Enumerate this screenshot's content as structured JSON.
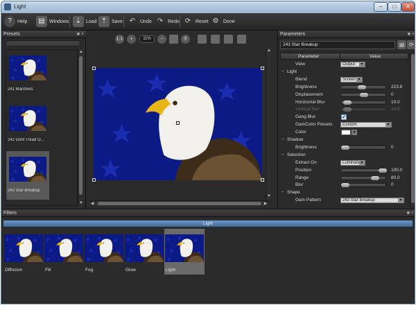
{
  "window": {
    "title": "Light",
    "min_label": "–",
    "max_label": "□",
    "close_label": "✕"
  },
  "toolbar": {
    "help": "Help",
    "windows": "Windows",
    "load": "Load",
    "save": "Save",
    "undo": "Undo",
    "redo": "Redo",
    "reset": "Reset",
    "done": "Done"
  },
  "presets": {
    "title": "Presets",
    "items": [
      {
        "label": "241 Marchers"
      },
      {
        "label": "242 Dont Tread O..."
      },
      {
        "label": "243 Star Breakup",
        "selected": true
      },
      {
        "label": ""
      }
    ]
  },
  "canvas": {
    "zoom": "11%"
  },
  "parameters": {
    "title": "Parameters",
    "preset_name": "243 Star Breakup",
    "col_parameter": "Parameter",
    "col_value": "Value",
    "rows": [
      {
        "kind": "dropdown",
        "name": "View",
        "value": "Output"
      },
      {
        "kind": "group",
        "name": "Light",
        "expander": "−"
      },
      {
        "kind": "slider_dropdown",
        "name": "Blend",
        "value": "Screen"
      },
      {
        "kind": "slider",
        "name": "Brightness",
        "value": "223.8",
        "level": 0.45
      },
      {
        "kind": "slider",
        "name": "Displacement",
        "value": "0",
        "level": 0.5
      },
      {
        "kind": "slider",
        "name": "Horizontal Blur",
        "value": "10.0",
        "level": 0.05
      },
      {
        "kind": "slider_dim",
        "name": "Vertical Blur",
        "value": "10.0",
        "level": 0.05
      },
      {
        "kind": "checkbox",
        "name": "Gang Blur",
        "checked": true
      },
      {
        "kind": "dropdown_wide",
        "name": "GamColor Presets",
        "value": "Custom"
      },
      {
        "kind": "color",
        "name": "Color",
        "value": "#ffffff"
      },
      {
        "kind": "group",
        "name": "Shadow",
        "expander": "−"
      },
      {
        "kind": "slider",
        "name": "Brightness",
        "value": "0",
        "level": 0.0
      },
      {
        "kind": "group",
        "name": "Selection",
        "expander": "−"
      },
      {
        "kind": "dropdown",
        "name": "Extract On",
        "value": "Luminance"
      },
      {
        "kind": "slider",
        "name": "Position",
        "value": "100.0",
        "level": 1.0
      },
      {
        "kind": "slider",
        "name": "Range",
        "value": "80.0",
        "level": 0.8
      },
      {
        "kind": "slider",
        "name": "Blur",
        "value": "0",
        "level": 0.0
      },
      {
        "kind": "group",
        "name": "Shape",
        "expander": "−"
      },
      {
        "kind": "dropdown_full",
        "name": "Gam Pattern",
        "value": "243 Star Breakup"
      }
    ]
  },
  "filters": {
    "title": "Filters",
    "active_tab": "Light",
    "items": [
      {
        "label": "Diffusion"
      },
      {
        "label": "Fill"
      },
      {
        "label": "Fog"
      },
      {
        "label": "Glow"
      },
      {
        "label": "Light",
        "selected": true
      }
    ]
  },
  "colors": {
    "accent": "#3c6a9c",
    "panel_bg": "#2b2b2b",
    "sky_blue": "#0d1a8a"
  }
}
